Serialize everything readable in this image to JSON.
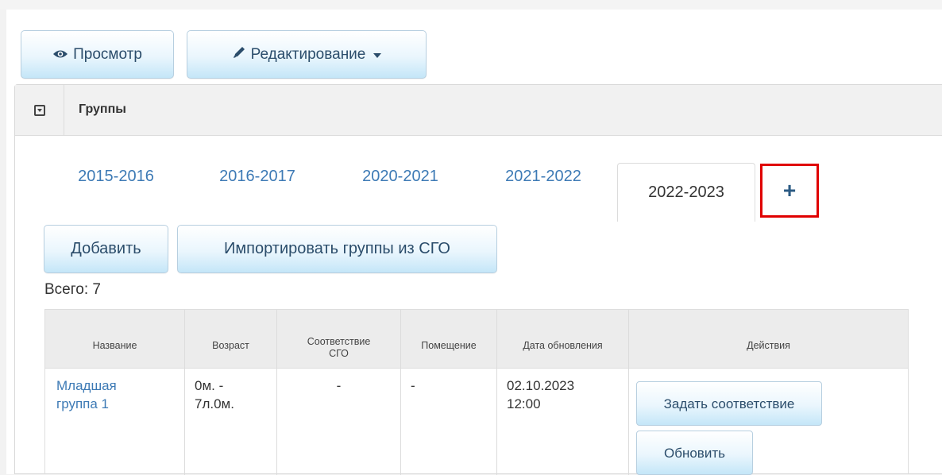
{
  "toolbar": {
    "view_label": "Просмотр",
    "edit_label": "Редактирование"
  },
  "panel": {
    "title": "Группы"
  },
  "tabs": [
    {
      "label": "2015-2016",
      "active": false
    },
    {
      "label": "2016-2017",
      "active": false
    },
    {
      "label": "2020-2021",
      "active": false
    },
    {
      "label": "2021-2022",
      "active": false
    },
    {
      "label": "2022-2023",
      "active": true
    }
  ],
  "add_tab_label": "+",
  "actions": {
    "add_label": "Добавить",
    "import_label": "Импортировать группы из СГО"
  },
  "total_label": "Всего: 7",
  "table": {
    "headers": {
      "name": "Название",
      "age": "Возраст",
      "sgo_match": "Соответствие СГО",
      "room": "Помещение",
      "updated": "Дата обновления",
      "actions": "Действия"
    },
    "rows": [
      {
        "name": "Младшая группа 1",
        "age": "0м. - 7л.0м.",
        "sgo_match": "-",
        "room": "-",
        "updated": "02.10.2023 12:00",
        "set_match_label": "Задать соответствие",
        "refresh_label": "Обновить"
      }
    ]
  },
  "colors": {
    "accent_link": "#3d7ab5",
    "highlight_border": "#e00000",
    "button_gradient_bottom": "#c4e6f8"
  },
  "icons": [
    "eye-icon",
    "pencil-icon",
    "chevron-down-icon",
    "collapse-icon",
    "plus-icon"
  ]
}
